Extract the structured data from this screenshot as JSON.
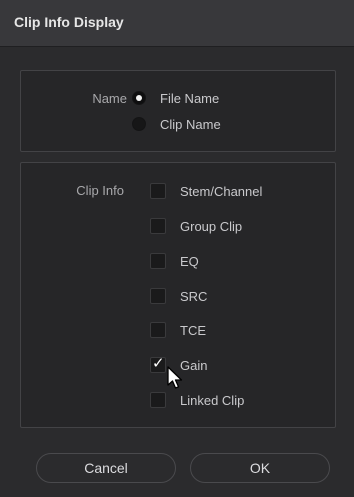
{
  "dialog": {
    "title": "Clip Info Display"
  },
  "name_section": {
    "label": "Name",
    "options": [
      {
        "label": "File Name",
        "selected": true
      },
      {
        "label": "Clip Name",
        "selected": false
      }
    ]
  },
  "clip_info_section": {
    "label": "Clip Info",
    "options": [
      {
        "label": "Stem/Channel",
        "checked": false
      },
      {
        "label": "Group Clip",
        "checked": false
      },
      {
        "label": "EQ",
        "checked": false
      },
      {
        "label": "SRC",
        "checked": false
      },
      {
        "label": "TCE",
        "checked": false
      },
      {
        "label": "Gain",
        "checked": true
      },
      {
        "label": "Linked Clip",
        "checked": false
      }
    ]
  },
  "buttons": {
    "cancel": "Cancel",
    "ok": "OK"
  },
  "icons": {
    "check": "check-icon",
    "cursor": "mouse-pointer-icon"
  }
}
